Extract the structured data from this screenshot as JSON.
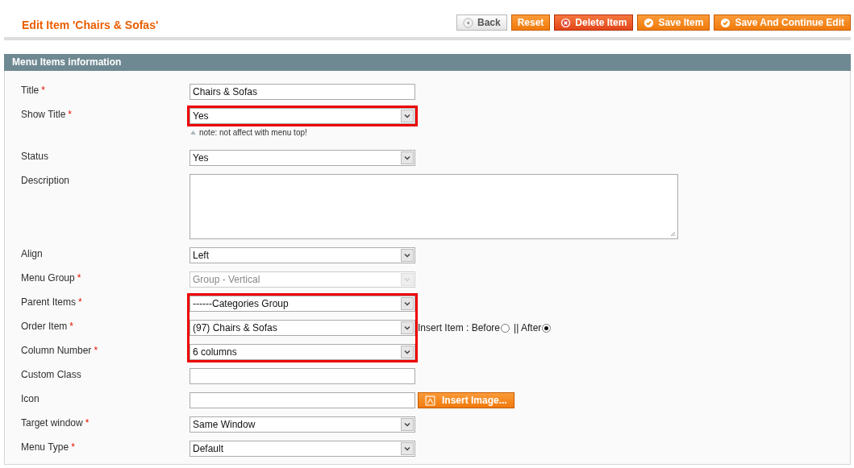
{
  "page_title": "Edit Item 'Chairs & Sofas'",
  "buttons": [
    {
      "label": "Back",
      "kind": "back"
    },
    {
      "label": "Reset",
      "kind": "plain"
    },
    {
      "label": "Delete Item",
      "kind": "delete"
    },
    {
      "label": "Save Item",
      "kind": "save"
    },
    {
      "label": "Save And Continue Edit",
      "kind": "save"
    }
  ],
  "section_title": "Menu Items information",
  "fields": [
    {
      "label": "Title",
      "required_mark": "*",
      "kind": "text",
      "value": "Chairs & Sofas",
      "disabled": false,
      "highlighted": false
    },
    {
      "label": "Show Title",
      "required_mark": "*",
      "kind": "select",
      "value": "Yes",
      "disabled": false,
      "highlighted": true,
      "note": "note: not affect with menu top!"
    },
    {
      "label": "Status",
      "kind": "select",
      "value": "Yes",
      "disabled": false,
      "highlighted": false
    },
    {
      "label": "Description",
      "kind": "textarea",
      "disabled": false,
      "highlighted": false
    },
    {
      "label": "Align",
      "kind": "select",
      "value": "Left",
      "disabled": false,
      "highlighted": false
    },
    {
      "label": "Menu Group",
      "required_mark": "*",
      "kind": "select",
      "value": "Group - Vertical",
      "disabled": true,
      "highlighted": false
    },
    {
      "label": "Parent Items",
      "required_mark": "*",
      "kind": "select",
      "value": "------Categories Group",
      "disabled": false,
      "highlighted": true
    },
    {
      "label": "Order Item",
      "required_mark": "*",
      "kind": "select",
      "value": "(97) Chairs & Sofas",
      "disabled": false,
      "highlighted": true,
      "options": [
        {
          "label": "Insert Item : Before",
          "selected": false
        },
        {
          "label": "|| After",
          "selected": true
        }
      ]
    },
    {
      "label": "Column Number",
      "required_mark": "*",
      "kind": "select",
      "value": "6 columns",
      "disabled": false,
      "highlighted": true
    },
    {
      "label": "Custom Class",
      "kind": "text",
      "disabled": false,
      "highlighted": false
    },
    {
      "label": "Icon",
      "kind": "file",
      "disabled": false,
      "highlighted": false,
      "button": "Insert Image..."
    },
    {
      "label": "Target window",
      "required_mark": "*",
      "kind": "select",
      "value": "Same Window",
      "disabled": false,
      "highlighted": false
    },
    {
      "label": "Menu Type",
      "required_mark": "*",
      "kind": "select",
      "value": "Default",
      "disabled": false,
      "highlighted": false
    }
  ]
}
